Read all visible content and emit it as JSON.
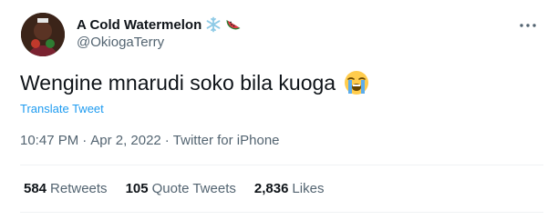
{
  "author": {
    "display_name": "A Cold Watermelon",
    "handle": "@OkiogaTerry",
    "name_emojis": [
      "snowflake-emoji",
      "watermelon-emoji"
    ]
  },
  "tweet": {
    "text": "Wengine mnarudi soko bila kuoga",
    "text_emoji": "loudly-crying-face-emoji",
    "translate_label": "Translate Tweet",
    "time": "10:47 PM",
    "date": "Apr 2, 2022",
    "source": "Twitter for iPhone",
    "separator": "·"
  },
  "stats": {
    "retweets_count": "584",
    "retweets_label": "Retweets",
    "quotes_count": "105",
    "quotes_label": "Quote Tweets",
    "likes_count": "2,836",
    "likes_label": "Likes"
  },
  "colors": {
    "text": "#0f1419",
    "secondary": "#536471",
    "link": "#1d9bf0",
    "divider": "#eff3f4"
  }
}
